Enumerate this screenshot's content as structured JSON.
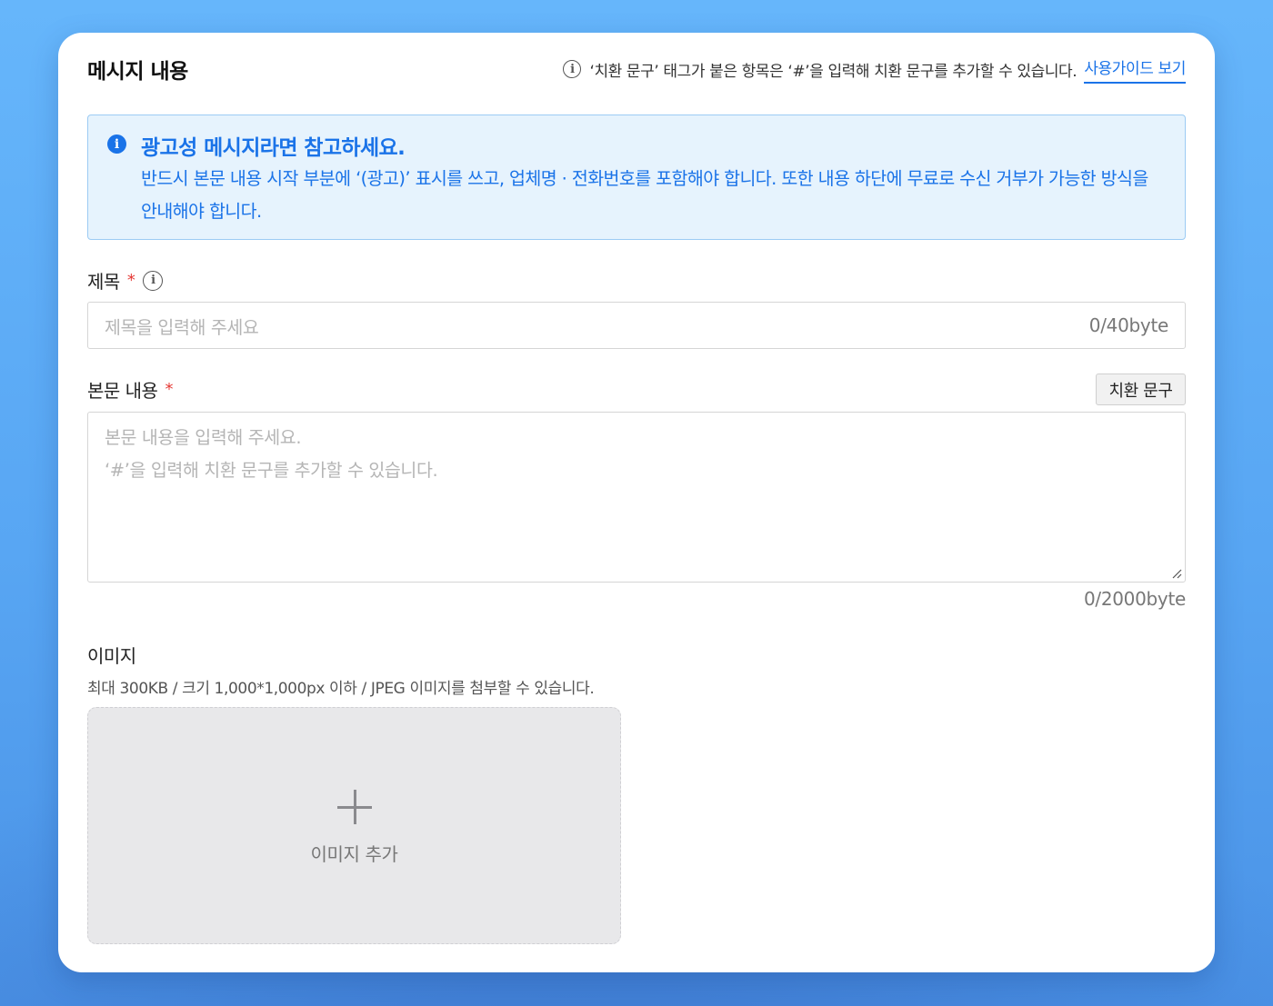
{
  "header": {
    "title": "메시지 내용",
    "hint": "‘치환 문구’ 태그가 붙은 항목은 ‘#’을 입력해 치환 문구를 추가할 수 있습니다.",
    "guide_link": "사용가이드 보기"
  },
  "notice": {
    "title": "광고성 메시지라면 참고하세요.",
    "body": "반드시 본문 내용 시작 부분에 ‘(광고)’ 표시를 쓰고, 업체명 · 전화번호를 포함해야 합니다. 또한 내용 하단에 무료로 수신 거부가 가능한 방식을 안내해야 합니다."
  },
  "title_field": {
    "label": "제목",
    "required_mark": "*",
    "placeholder": "제목을 입력해 주세요",
    "counter": "0/40byte"
  },
  "body_field": {
    "label": "본문 내용",
    "required_mark": "*",
    "substitution_button": "치환 문구",
    "placeholder_line1": "본문 내용을 입력해 주세요.",
    "placeholder_line2": "‘#’을 입력해 치환 문구를 추가할 수 있습니다.",
    "counter": "0/2000byte"
  },
  "image_field": {
    "label": "이미지",
    "description": "최대 300KB / 크기 1,000*1,000px 이하 / JPEG 이미지를 첨부할 수 있습니다.",
    "add_label": "이미지 추가"
  },
  "colors": {
    "accent": "#1a73e8",
    "required": "#e53935",
    "notice_bg": "#e6f3fd"
  }
}
